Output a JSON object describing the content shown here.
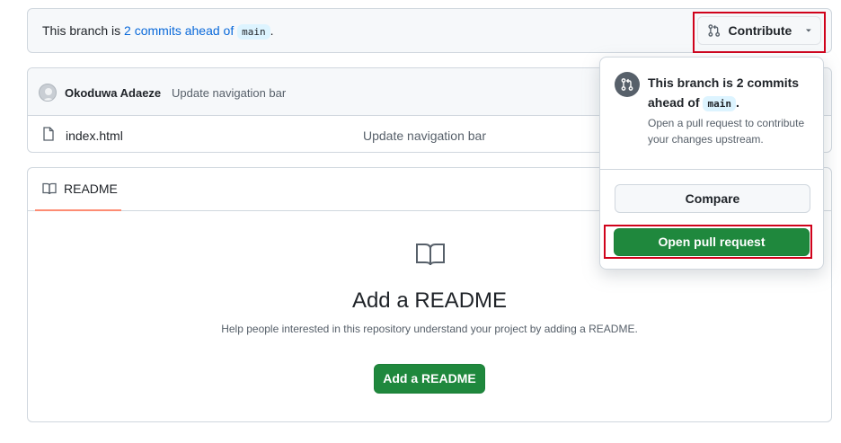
{
  "banner": {
    "prefix": "This branch is ",
    "link": "2 commits ahead of",
    "branch": "main",
    "suffix": "."
  },
  "contribute_button": {
    "label": "Contribute"
  },
  "latest_commit": {
    "author": "Okoduwa Adaeze",
    "message": "Update navigation bar"
  },
  "files": [
    {
      "name": "index.html",
      "message": "Update navigation bar"
    }
  ],
  "readme": {
    "tab_label": "README",
    "title": "Add a README",
    "description": "Help people interested in this repository understand your project by adding a README.",
    "button_label": "Add a README"
  },
  "popover": {
    "title_prefix": "This branch is 2 commits ahead of ",
    "branch": "main",
    "title_suffix": ".",
    "description": "Open a pull request to contribute your changes upstream.",
    "compare_label": "Compare",
    "open_pr_label": "Open pull request"
  },
  "colors": {
    "primary_green": "#1f883d",
    "link_blue": "#0969da",
    "highlight_red": "#d0021b",
    "tab_underline": "#fd8c73"
  }
}
